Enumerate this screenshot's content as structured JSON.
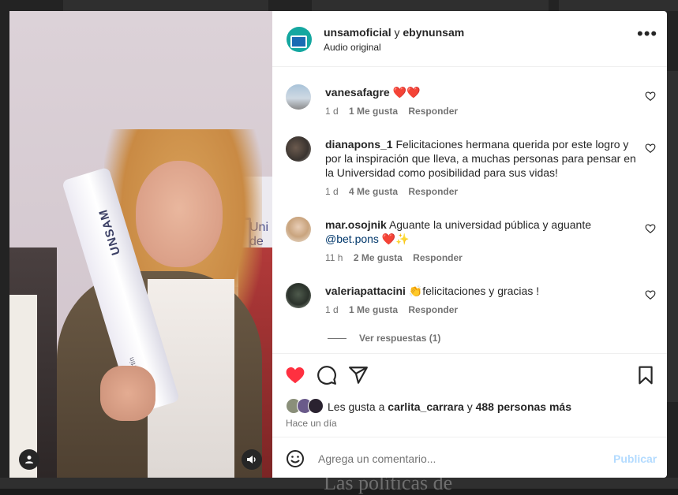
{
  "background": {
    "caption": "Las políticas de"
  },
  "media": {
    "tube_label": "UNSAM",
    "tube_sublabel": "al San Martín",
    "banner_text_1": "Uni",
    "banner_text_2": "de"
  },
  "header": {
    "user1": "unsamoficial",
    "connector": " y ",
    "user2": "ebynunsam",
    "subtitle": "Audio original"
  },
  "comments": [
    {
      "user": "vanesafagre",
      "text": "❤️❤️",
      "age": "1 d",
      "likes": "1 Me gusta",
      "reply": "Responder"
    },
    {
      "user": "dianapons_1",
      "text": "Felicitaciones hermana querida por este logro y por la inspiración que lleva, a muchas personas para pensar en la Universidad como posibilidad para sus vidas!",
      "age": "1 d",
      "likes": "4 Me gusta",
      "reply": "Responder"
    },
    {
      "user": "mar.osojnik",
      "text": "Aguante la universidad pública y aguante ",
      "mention": "@bet.pons",
      "text_end": " ❤️✨",
      "age": "11 h",
      "likes": "2 Me gusta",
      "reply": "Responder"
    },
    {
      "user": "valeriapattacini",
      "text": "👏felicitaciones y gracias !",
      "age": "1 d",
      "likes": "1 Me gusta",
      "reply": "Responder"
    }
  ],
  "view_replies": "Ver respuestas (1)",
  "likes": {
    "prefix": "Les gusta a ",
    "user": "carlita_carrara",
    "middle": " y ",
    "count": "488 personas más"
  },
  "time_ago": "Hace un día",
  "composer": {
    "placeholder": "Agrega un comentario...",
    "post_label": "Publicar"
  },
  "colors": {
    "like_red": "#ff3040",
    "link_blue": "#00376b",
    "post_blue": "#b3dbff"
  }
}
